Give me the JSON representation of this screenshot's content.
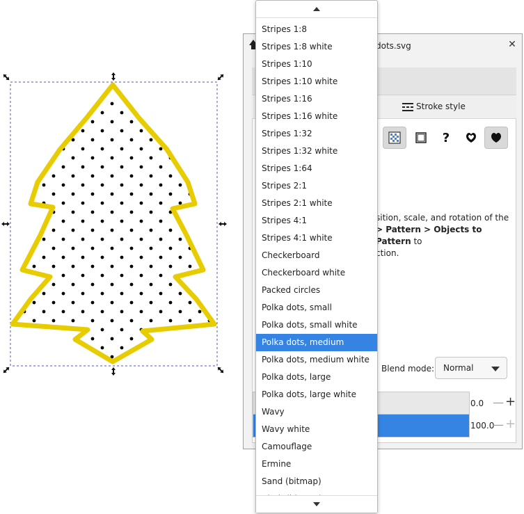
{
  "dialog": {
    "title": "dots.svg",
    "close_label": "✕",
    "stroke_style_tab": "Stroke style",
    "paint_buttons": [
      {
        "name": "pattern",
        "icon": "pattern-icon"
      },
      {
        "name": "swatch",
        "icon": "swatch-icon"
      },
      {
        "name": "unset",
        "icon": "unset-icon",
        "label": "?"
      },
      {
        "name": "fill-rule-evenodd",
        "icon": "evenodd-icon"
      },
      {
        "name": "fill-rule-nonzero",
        "icon": "nonzero-icon"
      }
    ],
    "help_text": {
      "line1": "sition, scale, and rotation of the",
      "line2_bold": "> Pattern > Objects to Pattern",
      "line2_rest": " to",
      "line3": "ction."
    },
    "blend_mode_label": "Blend mode:",
    "blend_mode_value": "Normal",
    "blur_value": "0.0",
    "opacity_value": "100.0",
    "opacity_level": 100,
    "blur_level": 0
  },
  "popup": {
    "items": [
      "Stripes 1:8",
      "Stripes 1:8 white",
      "Stripes 1:10",
      "Stripes 1:10 white",
      "Stripes 1:16",
      "Stripes 1:16 white",
      "Stripes 1:32",
      "Stripes 1:32 white",
      "Stripes 1:64",
      "Stripes 2:1",
      "Stripes 2:1 white",
      "Stripes 4:1",
      "Stripes 4:1 white",
      "Checkerboard",
      "Checkerboard white",
      "Packed circles",
      "Polka dots, small",
      "Polka dots, small white",
      "Polka dots, medium",
      "Polka dots, medium white",
      "Polka dots, large",
      "Polka dots, large white",
      "Wavy",
      "Wavy white",
      "Camouflage",
      "Ermine",
      "Sand (bitmap)",
      "Cloth (bitmap)"
    ],
    "selected": "Polka dots, medium"
  },
  "colors": {
    "accent": "#3584e4",
    "tree_stroke": "#e6cc00",
    "selection_box": "#5050c8"
  }
}
